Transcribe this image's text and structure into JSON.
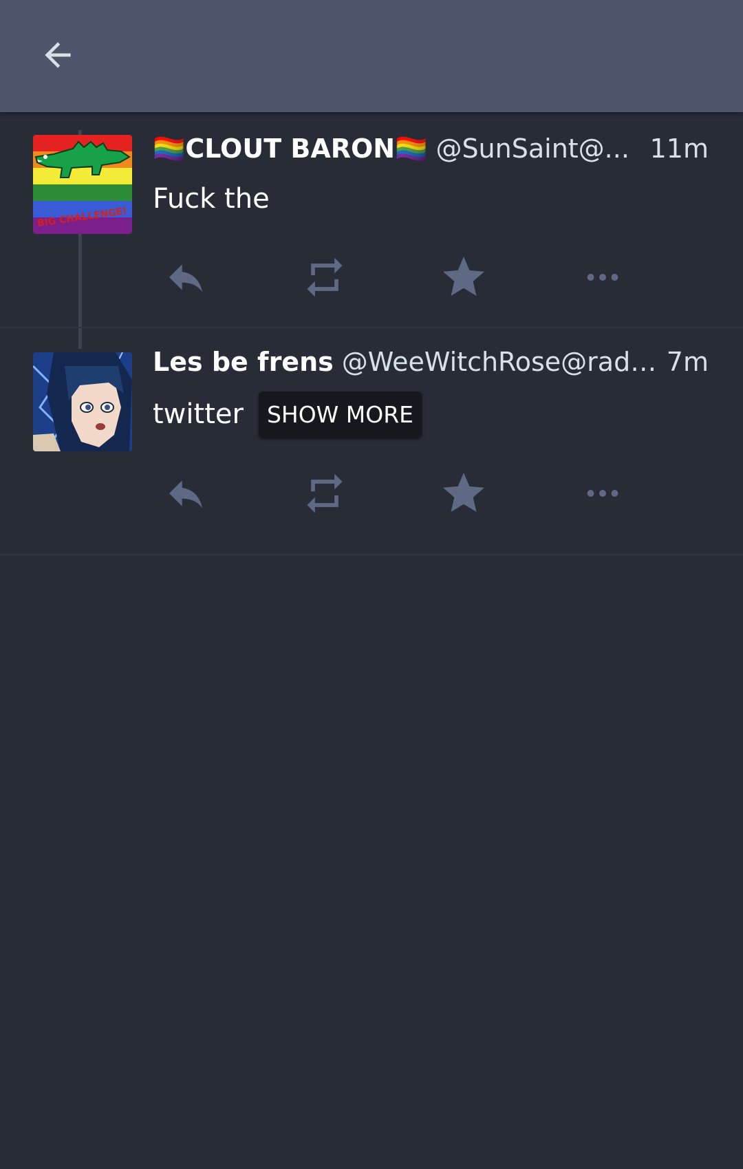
{
  "header": {
    "back_icon": "arrow-left-icon"
  },
  "statuses": [
    {
      "display_name": "🏳️‍🌈CLOUT BARON🏳️‍🌈",
      "acct": "@SunSaint@...",
      "time": "11m",
      "content": "Fuck the",
      "avatar_text": "BIG CHALLENGE!",
      "show_more": ""
    },
    {
      "display_name": "Les be frens",
      "acct": "@WeeWitchRose@radica...",
      "time": "7m",
      "content": "twitter",
      "show_more": "SHOW MORE"
    }
  ],
  "action_icons": [
    "reply-icon",
    "boost-icon",
    "favourite-icon",
    "more-icon"
  ],
  "colors": {
    "background": "#282c37",
    "topbar": "#4e546a",
    "icon": "#606984",
    "text": "#ffffff",
    "secondary_text": "#d9e1e8"
  }
}
